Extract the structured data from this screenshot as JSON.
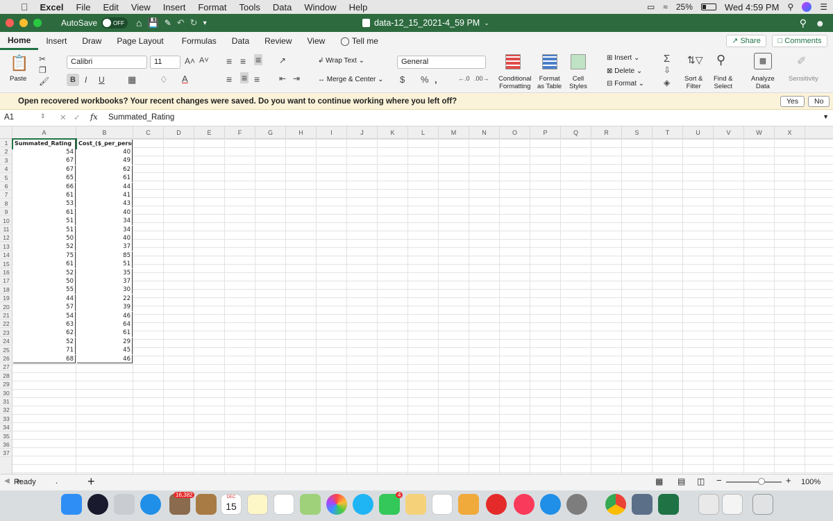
{
  "menubar": {
    "app": "Excel",
    "items": [
      "File",
      "Edit",
      "View",
      "Insert",
      "Format",
      "Tools",
      "Data",
      "Window",
      "Help"
    ],
    "battery": "25%",
    "datetime": "Wed 4:59 PM"
  },
  "titlebar": {
    "autosave": "AutoSave",
    "autosave_state": "OFF",
    "doc_title": "data-12_15_2021-4_59 PM"
  },
  "ribbon_tabs": [
    "Home",
    "Insert",
    "Draw",
    "Page Layout",
    "Formulas",
    "Data",
    "Review",
    "View"
  ],
  "tell_me": "Tell me",
  "share": "Share",
  "comments": "Comments",
  "ribbon": {
    "paste": "Paste",
    "font_name": "Calibri",
    "font_size": "11",
    "wrap_text": "Wrap Text",
    "merge_center": "Merge & Center",
    "number_format": "General",
    "conditional": "Conditional",
    "formatting": "Formatting",
    "format_as": "Format",
    "as_table": "as Table",
    "cell": "Cell",
    "styles": "Styles",
    "insert": "Insert",
    "delete": "Delete",
    "format": "Format",
    "sort": "Sort &",
    "filter": "Filter",
    "find": "Find &",
    "select": "Select",
    "analyze": "Analyze",
    "data": "Data",
    "sensitivity": "Sensitivity"
  },
  "message": {
    "text": "Open recovered workbooks? Your recent changes were saved. Do you want to continue working where you left off?",
    "yes": "Yes",
    "no": "No"
  },
  "formula_bar": {
    "cell_ref": "A1",
    "fx": "fx",
    "content": "Summated_Rating"
  },
  "columns": [
    "A",
    "B",
    "C",
    "D",
    "E",
    "F",
    "G",
    "H",
    "I",
    "J",
    "K",
    "L",
    "M",
    "N",
    "O",
    "P",
    "Q",
    "R",
    "S",
    "T",
    "U",
    "V",
    "W",
    "X"
  ],
  "rows": [
    "1",
    "2",
    "3",
    "4",
    "5",
    "6",
    "7",
    "8",
    "9",
    "10",
    "11",
    "12",
    "13",
    "14",
    "15",
    "16",
    "17",
    "18",
    "19",
    "20",
    "21",
    "22",
    "23",
    "24",
    "25",
    "26",
    "27",
    "28",
    "29",
    "30",
    "31",
    "32",
    "33",
    "34",
    "35",
    "36",
    "37"
  ],
  "headers": [
    "Summated_Rating",
    "Cost_($_per_person)"
  ],
  "table": [
    [
      "54",
      "40"
    ],
    [
      "67",
      "49"
    ],
    [
      "67",
      "62"
    ],
    [
      "65",
      "61"
    ],
    [
      "66",
      "44"
    ],
    [
      "61",
      "41"
    ],
    [
      "53",
      "43"
    ],
    [
      "61",
      "40"
    ],
    [
      "51",
      "34"
    ],
    [
      "51",
      "34"
    ],
    [
      "50",
      "40"
    ],
    [
      "52",
      "37"
    ],
    [
      "75",
      "85"
    ],
    [
      "61",
      "51"
    ],
    [
      "52",
      "35"
    ],
    [
      "50",
      "37"
    ],
    [
      "55",
      "30"
    ],
    [
      "44",
      "22"
    ],
    [
      "57",
      "39"
    ],
    [
      "54",
      "46"
    ],
    [
      "63",
      "64"
    ],
    [
      "62",
      "61"
    ],
    [
      "52",
      "29"
    ],
    [
      "71",
      "45"
    ],
    [
      "68",
      "46"
    ]
  ],
  "status": {
    "ready": "Ready",
    "zoom": "100%"
  },
  "dock": {
    "notifications": "16,382",
    "calendar_month": "DEC",
    "calendar_day": "15",
    "badge_4": "4"
  }
}
